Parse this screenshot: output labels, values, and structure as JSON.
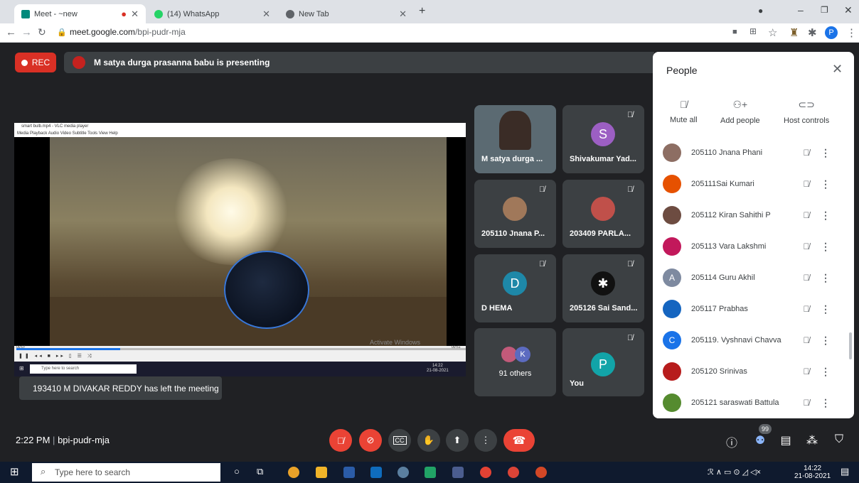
{
  "browser": {
    "tabs": [
      {
        "title": "Meet - ~new",
        "active": true
      },
      {
        "title": "(14) WhatsApp",
        "active": false
      },
      {
        "title": "New Tab",
        "active": false
      }
    ],
    "new_tab": "+",
    "url_domain": "meet.google.com",
    "url_path": "/bpi-pudr-mja"
  },
  "meet": {
    "rec_label": "REC",
    "presenting_text": "M satya durga prasanna babu is presenting",
    "shared_window": {
      "title": "smart bulb.mp4 - VLC media player",
      "menu": "Media  Playback  Audio  Video  Subtitle  Tools  View  Help",
      "time_left": "00:07",
      "time_right": "00:51",
      "activate_text": "Activate Windows",
      "progress_fraction": 0.23,
      "inner_search": "Type here to search",
      "inner_clock": "14:22",
      "inner_date": "21-08-2021"
    },
    "tiles": [
      {
        "name": "M satya durga ...",
        "avatar": "",
        "muted": false
      },
      {
        "name": "Shivakumar Yad...",
        "avatar": "S",
        "color": "#9c5fc3",
        "muted": true
      },
      {
        "name": "205110 Jnana P...",
        "avatar": "",
        "muted": true
      },
      {
        "name": "203409 PARLA...",
        "avatar": "",
        "muted": true
      },
      {
        "name": "D HEMA",
        "avatar": "D",
        "color": "#1e88a8",
        "muted": true
      },
      {
        "name": "205126 Sai Sand...",
        "avatar": "",
        "muted": true
      },
      {
        "name": "91 others",
        "avatar": "K",
        "color": "#5c6bc0",
        "muted": false
      },
      {
        "name": "You",
        "avatar": "P",
        "color": "#12a4a8",
        "muted": true
      }
    ],
    "toast": "193410 M DIVAKAR REDDY has left the meeting",
    "clock": "2:22 PM",
    "meeting_code": "bpi-pudr-mja",
    "people_badge": "99"
  },
  "people": {
    "title": "People",
    "actions": [
      "Mute all",
      "Add people",
      "Host controls"
    ],
    "list": [
      {
        "name": "205110 Jnana Phani",
        "avatar": "",
        "color": "#8d6e63"
      },
      {
        "name": "205111Sai Kumari",
        "avatar": "",
        "color": "#e65100"
      },
      {
        "name": "205112 Kiran Sahithi P",
        "avatar": "",
        "color": "#6d4c41"
      },
      {
        "name": "205113 Vara Lakshmi",
        "avatar": "",
        "color": "#c2185b"
      },
      {
        "name": "205114 Guru Akhil",
        "avatar": "A",
        "color": "#7e8aa0"
      },
      {
        "name": "205117 Prabhas",
        "avatar": "",
        "color": "#1565c0"
      },
      {
        "name": "205119. Vyshnavi Chavva",
        "avatar": "C",
        "color": "#1a73e8"
      },
      {
        "name": "205120 Srinivas",
        "avatar": "",
        "color": "#b71c1c"
      },
      {
        "name": "205121 saraswati Battula",
        "avatar": "",
        "color": "#558b2f"
      }
    ]
  },
  "taskbar": {
    "search_placeholder": "Type here to search",
    "time": "14:22",
    "date": "21-08-2021"
  }
}
